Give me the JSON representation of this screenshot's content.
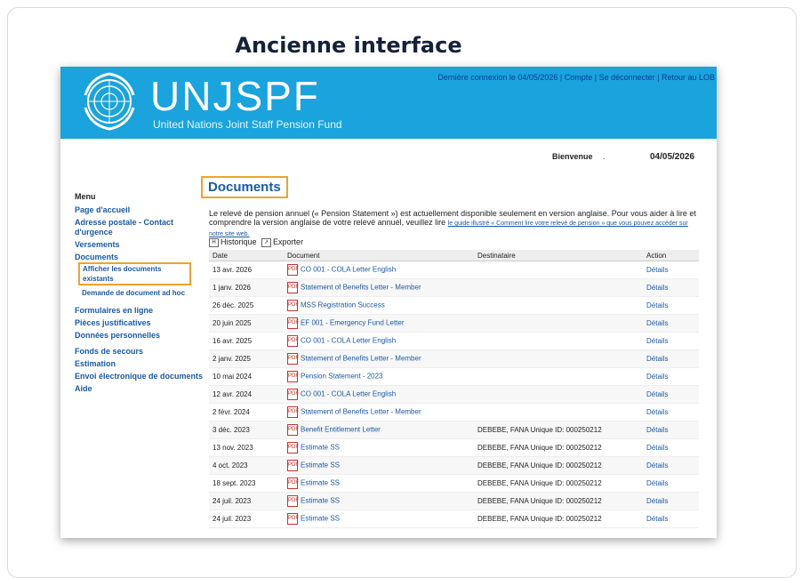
{
  "page_title": "Ancienne interface",
  "header": {
    "top_links": "Dernière connexion le 04/05/2026 | Compte | Se déconnecter | Retour au LOB",
    "brand": "UNJSPF",
    "brand_subtitle": "United Nations Joint Staff Pension Fund",
    "welcome": "Bienvenue",
    "welcome_suffix": ".",
    "date": "04/05/2026"
  },
  "menu": {
    "heading": "Menu",
    "items": [
      "Page d'accueil",
      "Adresse postale - Contact d'urgence",
      "Versements",
      "Documents"
    ],
    "sub_items": [
      "Afficher les documents existants",
      "Demande de document ad hoc"
    ],
    "items2": [
      "Formulaires en ligne",
      "Pièces justificatives",
      "Données personnelles",
      "Fonds de secours",
      "Estimation",
      "Envoi électronique de documents",
      "Aide"
    ]
  },
  "main": {
    "title": "Documents",
    "intro": "Le relevé de pension annuel (« Pension Statement ») est actuellement disponible seulement en version anglaise. Pour vous aider à lire et comprendre la version anglaise de votre relevé annuel, veuillez lire",
    "intro_link": "le guide illustré « Comment lire votre relevé de pension » que vous pouvez accéder sur notre site web.",
    "history_label": "Historique",
    "export_label": "Exporter",
    "columns": [
      "Date",
      "Document",
      "Destinataire",
      "Action"
    ],
    "rows": [
      {
        "date": "13 avr. 2026",
        "document": "CO 001 - COLA Letter English",
        "recipient": "",
        "action": "Détails"
      },
      {
        "date": "1 janv. 2026",
        "document": "Statement of Benefits Letter - Member",
        "recipient": "",
        "action": "Détails"
      },
      {
        "date": "26 déc. 2025",
        "document": "MSS Registration Success",
        "recipient": "",
        "action": "Détails"
      },
      {
        "date": "20 juin 2025",
        "document": "EF 001 - Emergency Fund Letter",
        "recipient": "",
        "action": "Détails"
      },
      {
        "date": "16 avr. 2025",
        "document": "CO 001 - COLA Letter English",
        "recipient": "",
        "action": "Détails"
      },
      {
        "date": "2 janv. 2025",
        "document": "Statement of Benefits Letter - Member",
        "recipient": "",
        "action": "Détails"
      },
      {
        "date": "10 mai 2024",
        "document": "Pension Statement - 2023",
        "recipient": "",
        "action": "Détails"
      },
      {
        "date": "12 avr. 2024",
        "document": "CO 001 - COLA Letter English",
        "recipient": "",
        "action": "Détails"
      },
      {
        "date": "2 févr. 2024",
        "document": "Statement of Benefits Letter - Member",
        "recipient": "",
        "action": "Détails"
      },
      {
        "date": "3 déc. 2023",
        "document": "Benefit Entitlement Letter",
        "recipient": "DEBEBE, FANA Unique ID: 000250212",
        "action": "Détails"
      },
      {
        "date": "13 nov. 2023",
        "document": "Estimate SS",
        "recipient": "DEBEBE, FANA Unique ID: 000250212",
        "action": "Détails"
      },
      {
        "date": "4 oct. 2023",
        "document": "Estimate SS",
        "recipient": "DEBEBE, FANA Unique ID: 000250212",
        "action": "Détails"
      },
      {
        "date": "18 sept. 2023",
        "document": "Estimate SS",
        "recipient": "DEBEBE, FANA Unique ID: 000250212",
        "action": "Détails"
      },
      {
        "date": "24 juil. 2023",
        "document": "Estimate SS",
        "recipient": "DEBEBE, FANA Unique ID: 000250212",
        "action": "Détails"
      },
      {
        "date": "24 juil. 2023",
        "document": "Estimate SS",
        "recipient": "DEBEBE, FANA Unique ID: 000250212",
        "action": "Détails"
      }
    ]
  },
  "colors": {
    "banner": "#1aa3dc",
    "link": "#1a5aa5",
    "highlight": "#f1a22c"
  }
}
